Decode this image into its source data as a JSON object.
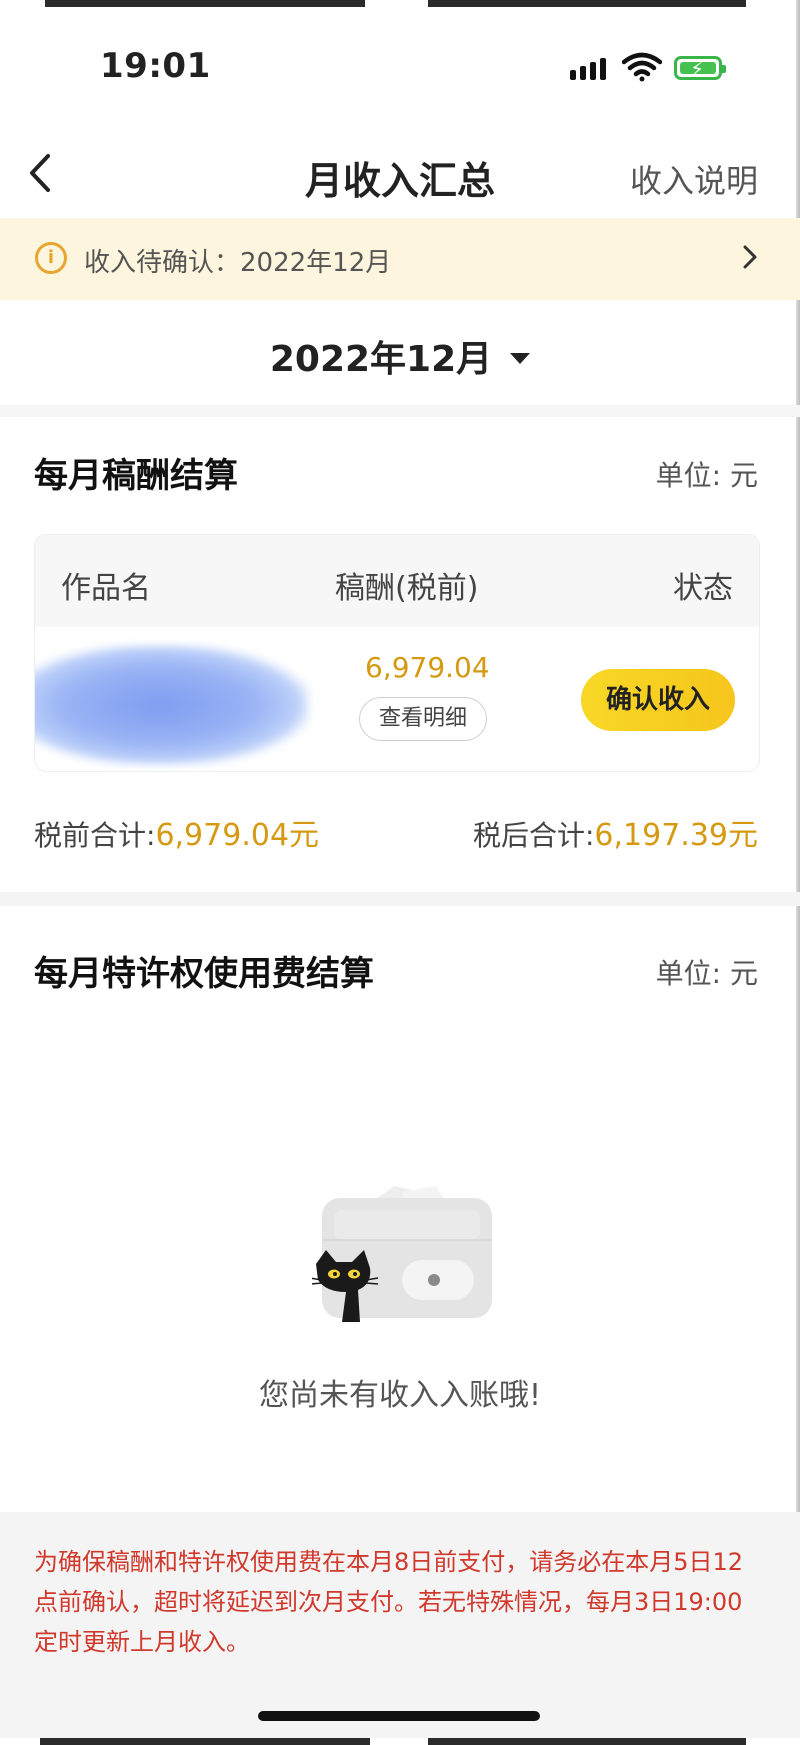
{
  "status_bar": {
    "time": "19:01",
    "signal_icon": "cellular-signal-icon",
    "wifi_icon": "wifi-icon",
    "battery_icon": "battery-charging-icon",
    "battery_color": "#45c14f"
  },
  "nav": {
    "back_icon": "chevron-left-icon",
    "title": "月收入汇总",
    "right_link": "收入说明"
  },
  "banner": {
    "icon": "info-icon",
    "text": "收入待确认：2022年12月",
    "chevron": "chevron-right-icon",
    "background": "#fdf5dd"
  },
  "month_selector": {
    "value": "2022年12月",
    "dropdown_icon": "caret-down-icon"
  },
  "manuscript_section": {
    "title": "每月稿酬结算",
    "unit": "单位: 元",
    "table": {
      "columns": [
        "作品名",
        "稿酬(税前)",
        "状态"
      ],
      "rows": [
        {
          "work_name_redacted": true,
          "amount": "6,979.04",
          "detail_button": "查看明细",
          "action_button": "确认收入"
        }
      ]
    },
    "pre_tax_label": "税前合计:",
    "pre_tax_value": "6,979.04元",
    "post_tax_label": "税后合计:",
    "post_tax_value": "6,197.39元",
    "accent_color": "#d69a12"
  },
  "royalty_section": {
    "title": "每月特许权使用费结算",
    "unit": "单位: 元",
    "empty_icon": "wallet-cat-illustration",
    "empty_text": "您尚未有收入入账哦!"
  },
  "footer_notice": {
    "text": "为确保稿酬和特许权使用费在本月8日前支付，请务必在本月5日12点前确认，超时将延迟到次月支付。若无特殊情况，每月3日19:00定时更新上月收入。",
    "color": "#d0392c"
  }
}
